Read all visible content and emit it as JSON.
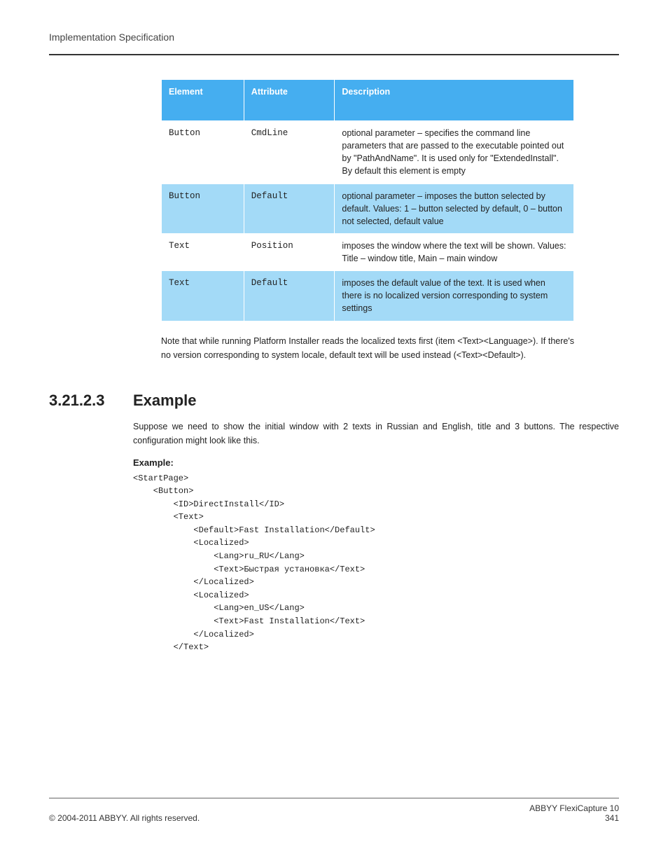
{
  "running_header": "Implementation Specification",
  "table": {
    "headers": [
      "Element",
      "Attribute",
      "Description"
    ],
    "rows": [
      {
        "element": "Button",
        "attribute": "CmdLine",
        "description": "optional parameter – specifies the command line parameters that are passed to the executable pointed out by \"PathAndName\". It is used only for \"ExtendedInstall\". By default this element is empty"
      },
      {
        "element": "Button",
        "attribute": "Default",
        "description": "optional parameter – imposes the button selected by default. Values: 1 – button selected by default, 0 – button not selected, default value"
      },
      {
        "element": "Text",
        "attribute": "Position",
        "description": "imposes the window where the text will be shown. Values: Title – window title, Main – main window"
      },
      {
        "element": "Text",
        "attribute": "Default",
        "description": "imposes the default value of the text. It is used when there is no localized version corresponding to system settings"
      }
    ]
  },
  "note": "Note that while running Platform Installer reads the localized texts first (item <Text><Language>). If there's no version corresponding to system locale, default text will be used instead (<Text><Default>).",
  "section": {
    "number": "3.21.2.3",
    "title": "Example"
  },
  "example_intro": "Suppose we need to show the initial window with 2 texts in Russian and English, title and 3 buttons. The respective configuration might look like this.",
  "example_label": "Example:",
  "code": "<StartPage>\n    <Button>\n        <ID>DirectInstall</ID>\n        <Text>\n            <Default>Fast Installation</Default>\n            <Localized>\n                <Lang>ru_RU</Lang>\n                <Text>Быстрая установка</Text>\n            </Localized>\n            <Localized>\n                <Lang>en_US</Lang>\n                <Text>Fast Installation</Text>\n            </Localized>\n        </Text>",
  "footer": {
    "left": "© 2004-2011 ABBYY. All rights reserved.",
    "right_line1": "ABBYY FlexiCapture 10",
    "right_line2": "341"
  }
}
